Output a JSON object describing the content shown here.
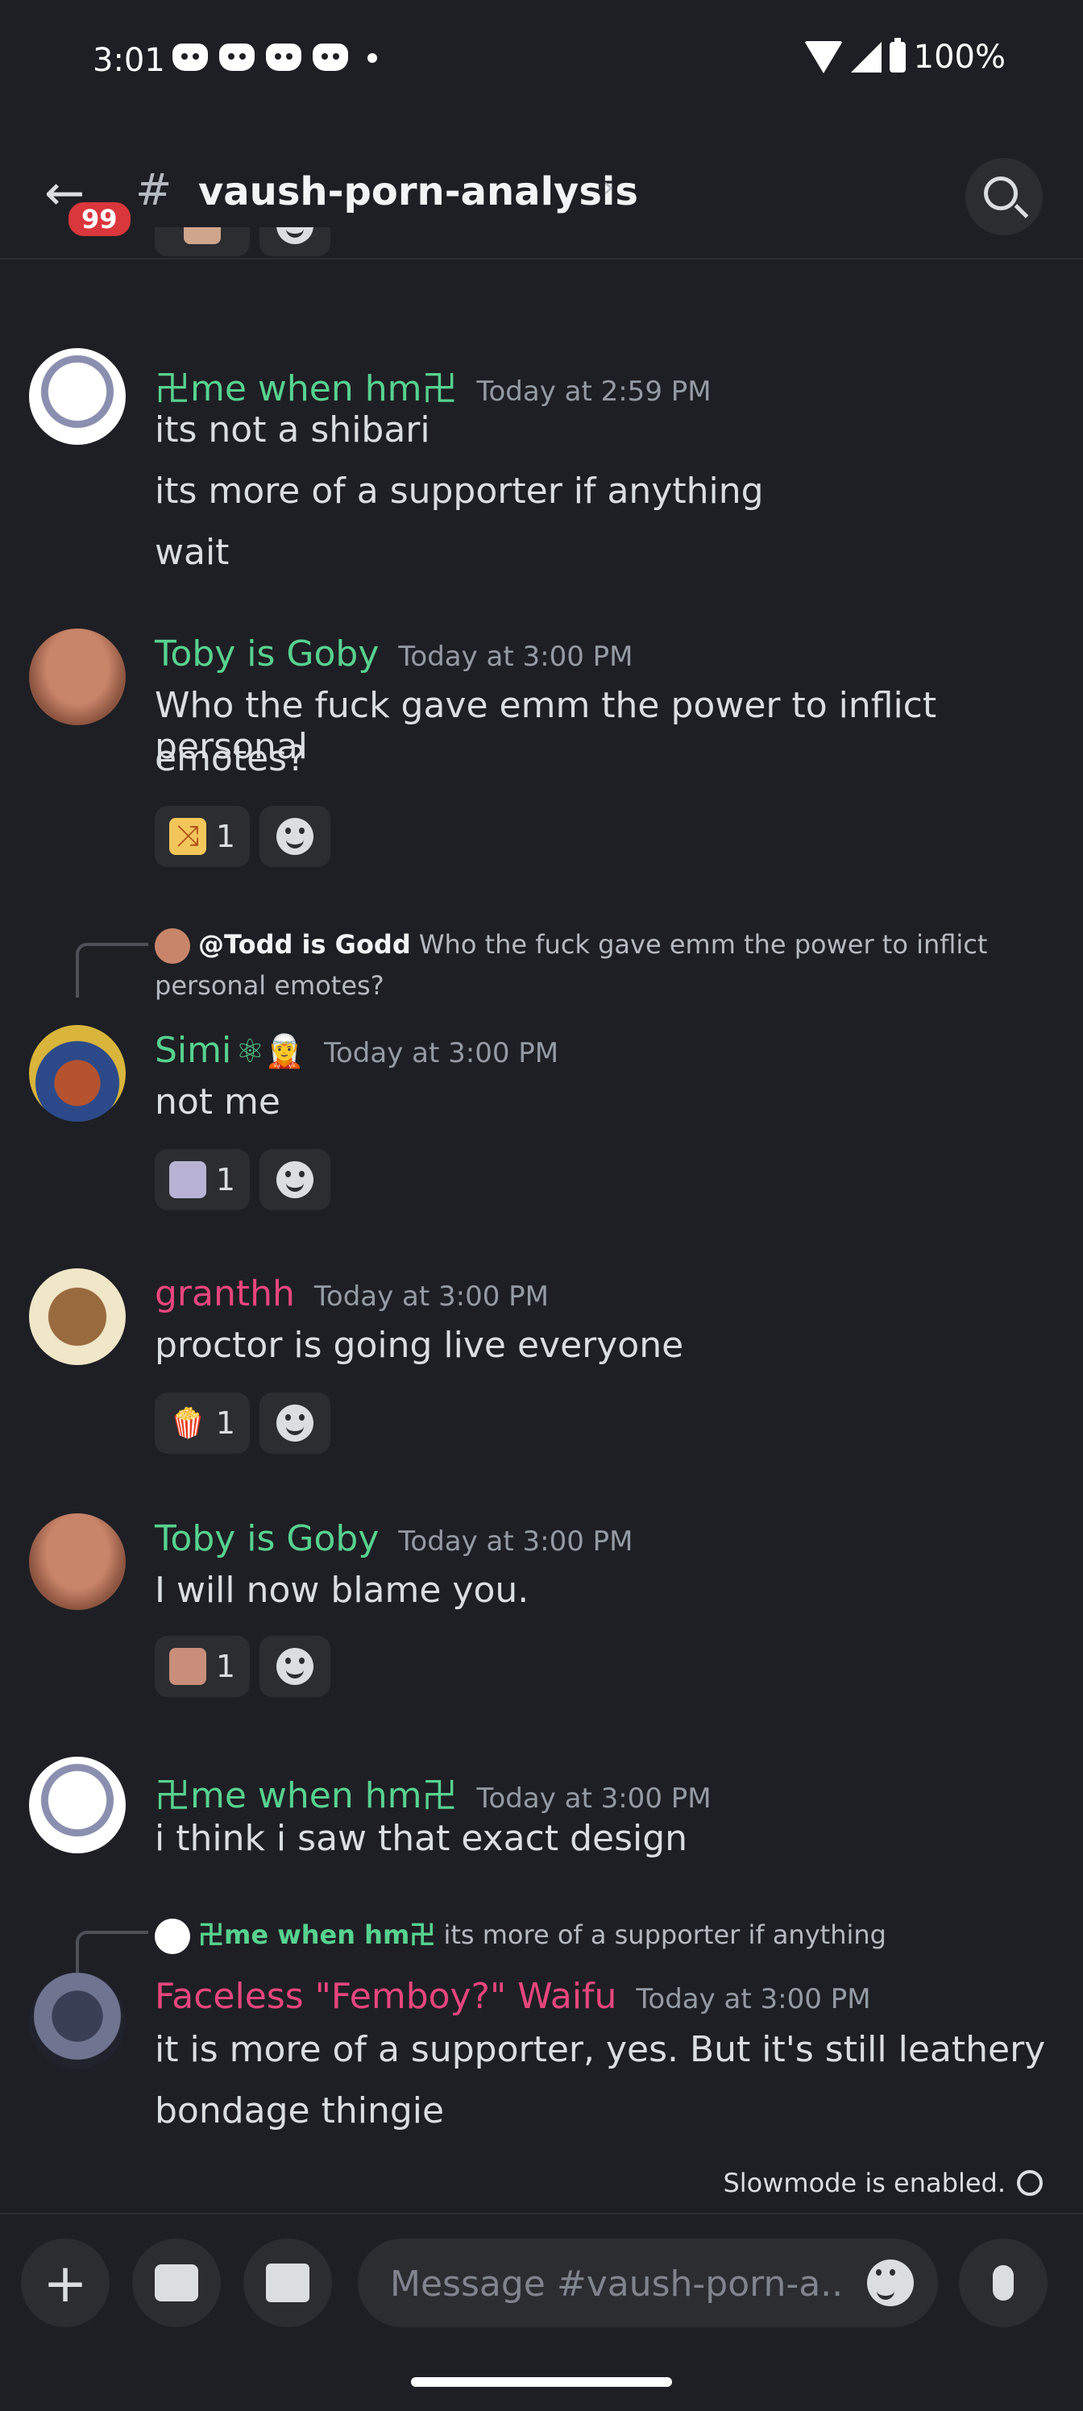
{
  "status_bar": {
    "time": "3:01",
    "battery": "100%"
  },
  "header": {
    "back_badge": "99",
    "channel": "vaush-porn-analysis"
  },
  "messages": [
    {
      "author": "卍me when hm卍",
      "time": "Today at 2:59 PM",
      "lines": [
        "its not a shibari",
        "its more of a supporter if anything",
        "wait"
      ],
      "color": "#57d28f"
    },
    {
      "author": "Toby is Goby",
      "time": "Today at 3:00 PM",
      "lines": [
        "Who the fuck gave emm the power to inflict personal",
        "emotes?"
      ],
      "reaction_count": "1",
      "color": "#57d28f"
    },
    {
      "reply_to": "@Todd is Godd",
      "reply_text": "Who the fuck gave emm the power to inflict",
      "reply_text2": "personal emotes?",
      "author": "Simi",
      "badges": "⚛🧝",
      "time": "Today at 3:00 PM",
      "lines": [
        "not me"
      ],
      "reaction_count": "1",
      "color": "#57d28f"
    },
    {
      "author": "granthh",
      "time": "Today at 3:00 PM",
      "lines": [
        "proctor is going live everyone"
      ],
      "reaction_count": "1",
      "color": "#e8467c"
    },
    {
      "author": "Toby is Goby",
      "time": "Today at 3:00 PM",
      "lines": [
        "I will now blame you."
      ],
      "reaction_count": "1",
      "color": "#57d28f"
    },
    {
      "author": "卍me when hm卍",
      "time": "Today at 3:00 PM",
      "lines": [
        "i think i saw that exact design"
      ],
      "color": "#57d28f"
    },
    {
      "reply_to": "卍me when hm卍",
      "reply_text": "its more of a supporter if anything",
      "author": "Faceless \"Femboy?\" Waifu",
      "time": "Today at 3:00 PM",
      "lines": [
        "it is more of a supporter, yes. But it's still leathery",
        "bondage thingie"
      ],
      "color": "#e8467c"
    }
  ],
  "footer": {
    "slowmode": "Slowmode is enabled.",
    "input_placeholder": "Message #vaush-porn-a..."
  },
  "icons": [
    "discord-icon",
    "wifi-icon",
    "signal-icon",
    "battery-icon",
    "back-arrow-icon",
    "hash-icon",
    "search-icon",
    "add-reaction-icon",
    "plus-icon",
    "image-icon",
    "gift-icon",
    "emoji-icon",
    "mic-icon",
    "timer-icon"
  ]
}
